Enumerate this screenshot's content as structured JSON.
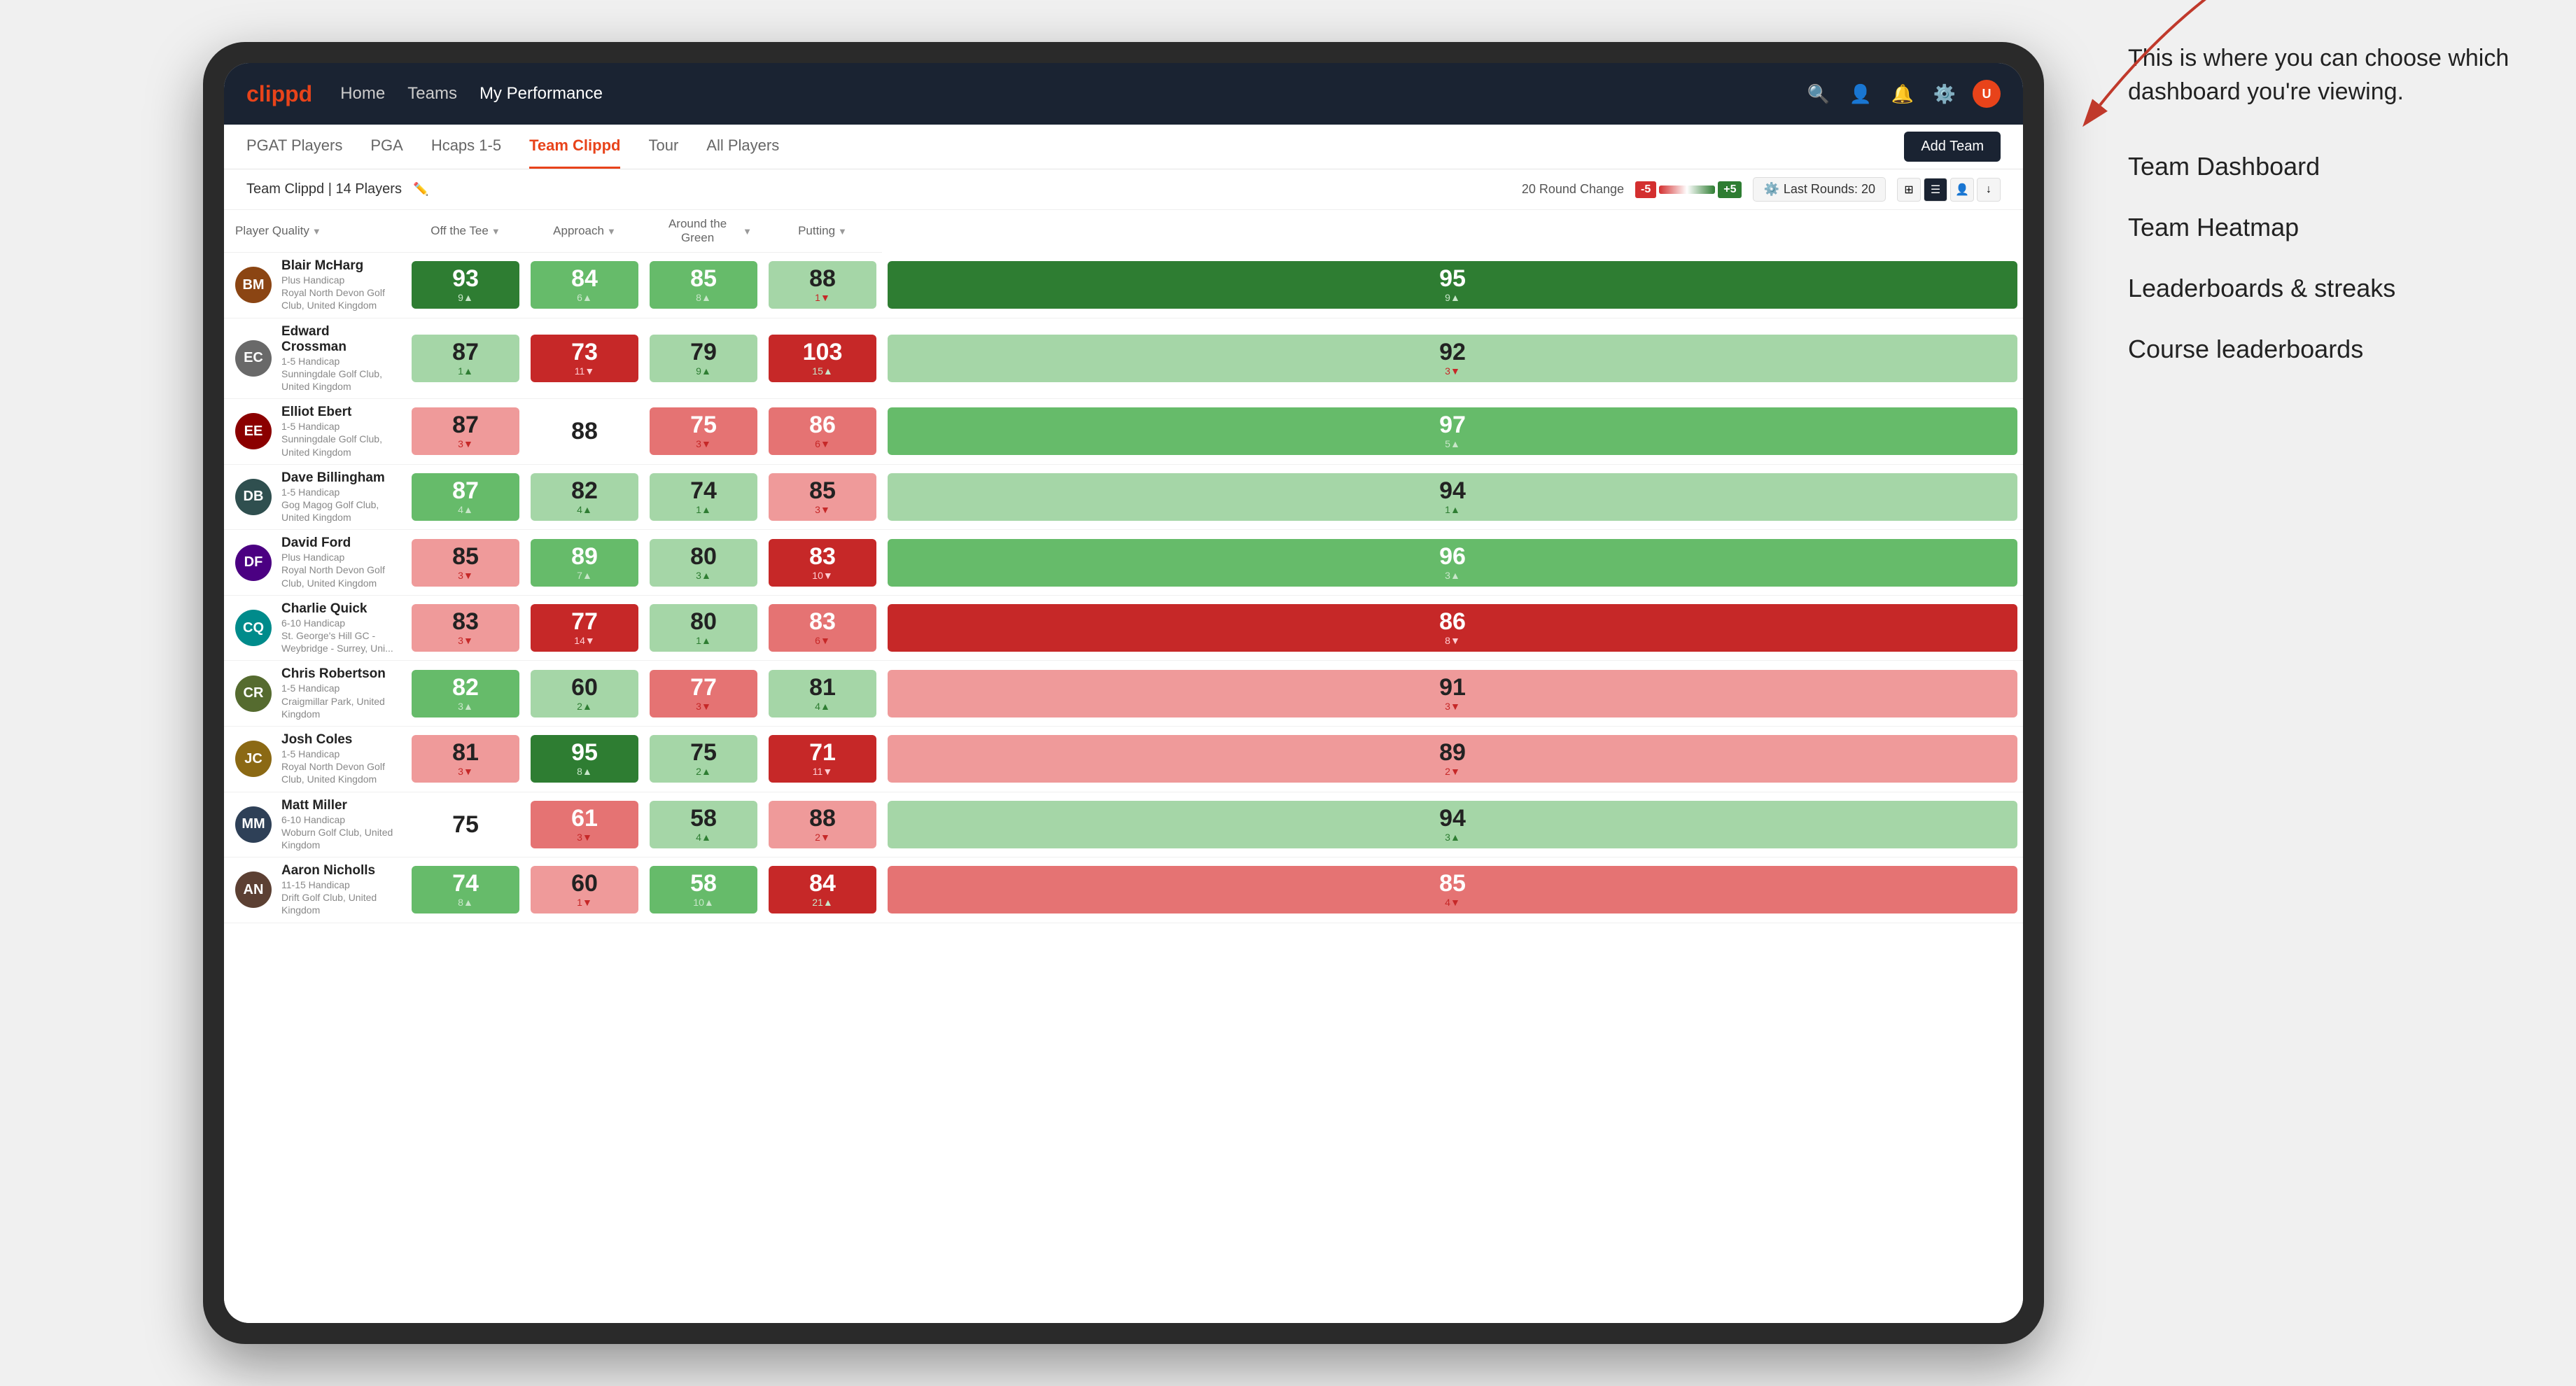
{
  "annotation": {
    "intro": "This is where you can choose which dashboard you're viewing.",
    "items": [
      "Team Dashboard",
      "Team Heatmap",
      "Leaderboards & streaks",
      "Course leaderboards"
    ]
  },
  "nav": {
    "logo": "clippd",
    "links": [
      "Home",
      "Teams",
      "My Performance"
    ],
    "active_link": "My Performance"
  },
  "tabs": {
    "items": [
      "PGAT Players",
      "PGA",
      "Hcaps 1-5",
      "Team Clippd",
      "Tour",
      "All Players"
    ],
    "active": "Team Clippd",
    "add_team": "Add Team"
  },
  "sub_header": {
    "team_label": "Team Clippd | 14 Players",
    "round_change_label": "20 Round Change",
    "neg_label": "-5",
    "pos_label": "+5",
    "last_rounds_label": "Last Rounds: 20"
  },
  "table": {
    "headers": {
      "player": "Player Quality",
      "off_tee": "Off the Tee",
      "approach": "Approach",
      "around_green": "Around the Green",
      "putting": "Putting"
    },
    "players": [
      {
        "name": "Blair McHarg",
        "handicap": "Plus Handicap",
        "club": "Royal North Devon Golf Club, United Kingdom",
        "initials": "BM",
        "quality": {
          "score": "93",
          "change": "9",
          "dir": "up",
          "heat": "heat-strong-green"
        },
        "off_tee": {
          "score": "84",
          "change": "6",
          "dir": "up",
          "heat": "heat-medium-green"
        },
        "approach": {
          "score": "85",
          "change": "8",
          "dir": "up",
          "heat": "heat-medium-green"
        },
        "around_green": {
          "score": "88",
          "change": "1",
          "dir": "down",
          "heat": "heat-light-green"
        },
        "putting": {
          "score": "95",
          "change": "9",
          "dir": "up",
          "heat": "heat-strong-green"
        }
      },
      {
        "name": "Edward Crossman",
        "handicap": "1-5 Handicap",
        "club": "Sunningdale Golf Club, United Kingdom",
        "initials": "EC",
        "quality": {
          "score": "87",
          "change": "1",
          "dir": "up",
          "heat": "heat-light-green"
        },
        "off_tee": {
          "score": "73",
          "change": "11",
          "dir": "down",
          "heat": "heat-strong-red"
        },
        "approach": {
          "score": "79",
          "change": "9",
          "dir": "up",
          "heat": "heat-light-green"
        },
        "around_green": {
          "score": "103",
          "change": "15",
          "dir": "up",
          "heat": "heat-strong-red"
        },
        "putting": {
          "score": "92",
          "change": "3",
          "dir": "down",
          "heat": "heat-light-green"
        }
      },
      {
        "name": "Elliot Ebert",
        "handicap": "1-5 Handicap",
        "club": "Sunningdale Golf Club, United Kingdom",
        "initials": "EE",
        "quality": {
          "score": "87",
          "change": "3",
          "dir": "down",
          "heat": "heat-light-red"
        },
        "off_tee": {
          "score": "88",
          "change": "",
          "dir": "",
          "heat": "heat-white"
        },
        "approach": {
          "score": "75",
          "change": "3",
          "dir": "down",
          "heat": "heat-medium-red"
        },
        "around_green": {
          "score": "86",
          "change": "6",
          "dir": "down",
          "heat": "heat-medium-red"
        },
        "putting": {
          "score": "97",
          "change": "5",
          "dir": "up",
          "heat": "heat-medium-green"
        }
      },
      {
        "name": "Dave Billingham",
        "handicap": "1-5 Handicap",
        "club": "Gog Magog Golf Club, United Kingdom",
        "initials": "DB",
        "quality": {
          "score": "87",
          "change": "4",
          "dir": "up",
          "heat": "heat-medium-green"
        },
        "off_tee": {
          "score": "82",
          "change": "4",
          "dir": "up",
          "heat": "heat-light-green"
        },
        "approach": {
          "score": "74",
          "change": "1",
          "dir": "up",
          "heat": "heat-light-green"
        },
        "around_green": {
          "score": "85",
          "change": "3",
          "dir": "down",
          "heat": "heat-light-red"
        },
        "putting": {
          "score": "94",
          "change": "1",
          "dir": "up",
          "heat": "heat-light-green"
        }
      },
      {
        "name": "David Ford",
        "handicap": "Plus Handicap",
        "club": "Royal North Devon Golf Club, United Kingdom",
        "initials": "DF",
        "quality": {
          "score": "85",
          "change": "3",
          "dir": "down",
          "heat": "heat-light-red"
        },
        "off_tee": {
          "score": "89",
          "change": "7",
          "dir": "up",
          "heat": "heat-medium-green"
        },
        "approach": {
          "score": "80",
          "change": "3",
          "dir": "up",
          "heat": "heat-light-green"
        },
        "around_green": {
          "score": "83",
          "change": "10",
          "dir": "down",
          "heat": "heat-strong-red"
        },
        "putting": {
          "score": "96",
          "change": "3",
          "dir": "up",
          "heat": "heat-medium-green"
        }
      },
      {
        "name": "Charlie Quick",
        "handicap": "6-10 Handicap",
        "club": "St. George's Hill GC - Weybridge - Surrey, Uni...",
        "initials": "CQ",
        "quality": {
          "score": "83",
          "change": "3",
          "dir": "down",
          "heat": "heat-light-red"
        },
        "off_tee": {
          "score": "77",
          "change": "14",
          "dir": "down",
          "heat": "heat-strong-red"
        },
        "approach": {
          "score": "80",
          "change": "1",
          "dir": "up",
          "heat": "heat-light-green"
        },
        "around_green": {
          "score": "83",
          "change": "6",
          "dir": "down",
          "heat": "heat-medium-red"
        },
        "putting": {
          "score": "86",
          "change": "8",
          "dir": "down",
          "heat": "heat-strong-red"
        }
      },
      {
        "name": "Chris Robertson",
        "handicap": "1-5 Handicap",
        "club": "Craigmillar Park, United Kingdom",
        "initials": "CR",
        "quality": {
          "score": "82",
          "change": "3",
          "dir": "up",
          "heat": "heat-medium-green"
        },
        "off_tee": {
          "score": "60",
          "change": "2",
          "dir": "up",
          "heat": "heat-light-green"
        },
        "approach": {
          "score": "77",
          "change": "3",
          "dir": "down",
          "heat": "heat-medium-red"
        },
        "around_green": {
          "score": "81",
          "change": "4",
          "dir": "up",
          "heat": "heat-light-green"
        },
        "putting": {
          "score": "91",
          "change": "3",
          "dir": "down",
          "heat": "heat-light-red"
        }
      },
      {
        "name": "Josh Coles",
        "handicap": "1-5 Handicap",
        "club": "Royal North Devon Golf Club, United Kingdom",
        "initials": "JC",
        "quality": {
          "score": "81",
          "change": "3",
          "dir": "down",
          "heat": "heat-light-red"
        },
        "off_tee": {
          "score": "95",
          "change": "8",
          "dir": "up",
          "heat": "heat-strong-green"
        },
        "approach": {
          "score": "75",
          "change": "2",
          "dir": "up",
          "heat": "heat-light-green"
        },
        "around_green": {
          "score": "71",
          "change": "11",
          "dir": "down",
          "heat": "heat-strong-red"
        },
        "putting": {
          "score": "89",
          "change": "2",
          "dir": "down",
          "heat": "heat-light-red"
        }
      },
      {
        "name": "Matt Miller",
        "handicap": "6-10 Handicap",
        "club": "Woburn Golf Club, United Kingdom",
        "initials": "MM",
        "quality": {
          "score": "75",
          "change": "",
          "dir": "",
          "heat": "heat-white"
        },
        "off_tee": {
          "score": "61",
          "change": "3",
          "dir": "down",
          "heat": "heat-medium-red"
        },
        "approach": {
          "score": "58",
          "change": "4",
          "dir": "up",
          "heat": "heat-light-green"
        },
        "around_green": {
          "score": "88",
          "change": "2",
          "dir": "down",
          "heat": "heat-light-red"
        },
        "putting": {
          "score": "94",
          "change": "3",
          "dir": "up",
          "heat": "heat-light-green"
        }
      },
      {
        "name": "Aaron Nicholls",
        "handicap": "11-15 Handicap",
        "club": "Drift Golf Club, United Kingdom",
        "initials": "AN",
        "quality": {
          "score": "74",
          "change": "8",
          "dir": "up",
          "heat": "heat-medium-green"
        },
        "off_tee": {
          "score": "60",
          "change": "1",
          "dir": "down",
          "heat": "heat-light-red"
        },
        "approach": {
          "score": "58",
          "change": "10",
          "dir": "up",
          "heat": "heat-medium-green"
        },
        "around_green": {
          "score": "84",
          "change": "21",
          "dir": "up",
          "heat": "heat-strong-red"
        },
        "putting": {
          "score": "85",
          "change": "4",
          "dir": "down",
          "heat": "heat-medium-red"
        }
      }
    ]
  }
}
